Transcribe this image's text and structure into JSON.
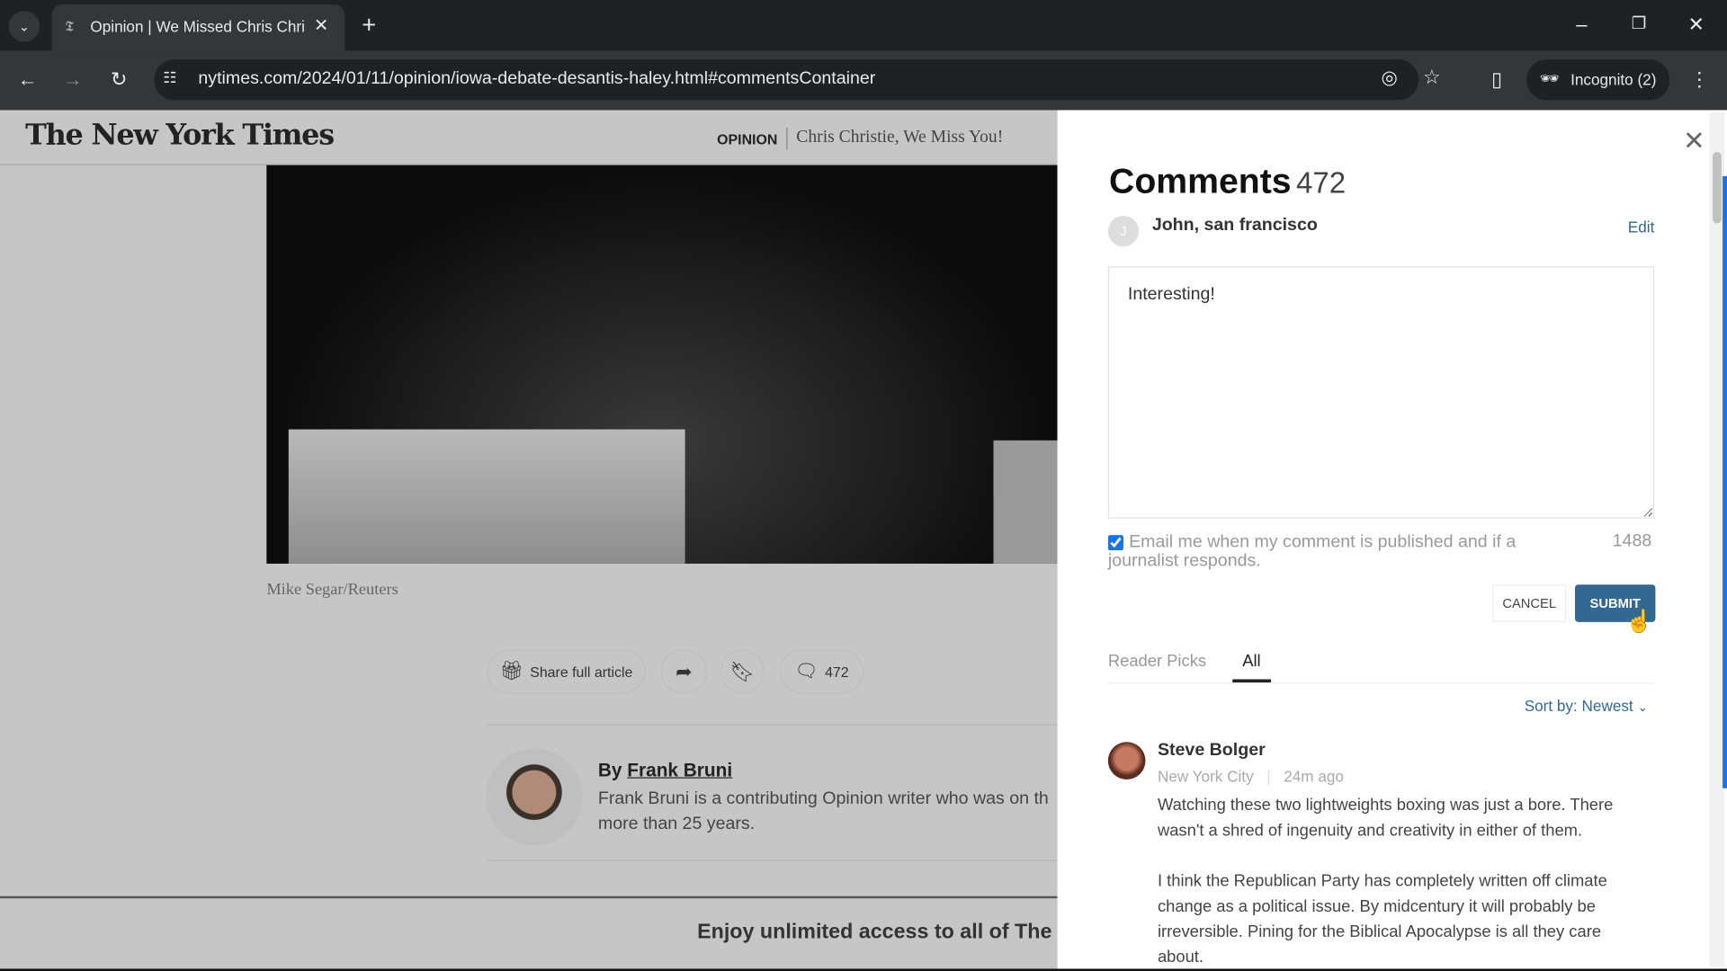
{
  "browser": {
    "tab_title": "Opinion | We Missed Chris Chri",
    "url": "nytimes.com/2024/01/11/opinion/iowa-debate-desantis-haley.html#commentsContainer",
    "incognito_label": "Incognito (2)"
  },
  "article": {
    "logo": "The New York Times",
    "section": "OPINION",
    "headline": "Chris Christie, We Miss You!",
    "photo_credit": "Mike Segar/Reuters",
    "share_label": "Share full article",
    "comment_count": "472",
    "byline_prefix": "By",
    "author": "Frank Bruni",
    "author_bio_1": "Frank Bruni is a contributing Opinion writer who was on th",
    "author_bio_2": "more than 25 years.",
    "promo": "Enjoy unlimited access to all of The T"
  },
  "comments": {
    "title": "Comments",
    "count": "472",
    "user_initial": "J",
    "user_name": "John, san francisco",
    "edit_label": "Edit",
    "draft": "Interesting!",
    "email_opt_in": "Email me when my comment is published and if a journalist responds.",
    "email_checked": true,
    "chars_remaining": "1488",
    "cancel_label": "CANCEL",
    "submit_label": "SUBMIT",
    "tabs": [
      {
        "label": "Reader Picks",
        "active": false
      },
      {
        "label": "All",
        "active": true
      }
    ],
    "sort_label": "Sort by: Newest",
    "items": [
      {
        "name": "Steve Bolger",
        "location": "New York City",
        "time": "24m ago",
        "para1": "Watching these two lightweights boxing was just a bore. There wasn't a shred of ingenuity and creativity in either of them.",
        "para2": "I think the Republican Party has completely written off climate change as a political issue. By midcentury it will probably be irreversible. Pining for the Biblical Apocalypse is all they care about."
      }
    ]
  },
  "colors": {
    "submit": "#326891",
    "link": "#326891",
    "checkbox": "#1a73e8"
  }
}
